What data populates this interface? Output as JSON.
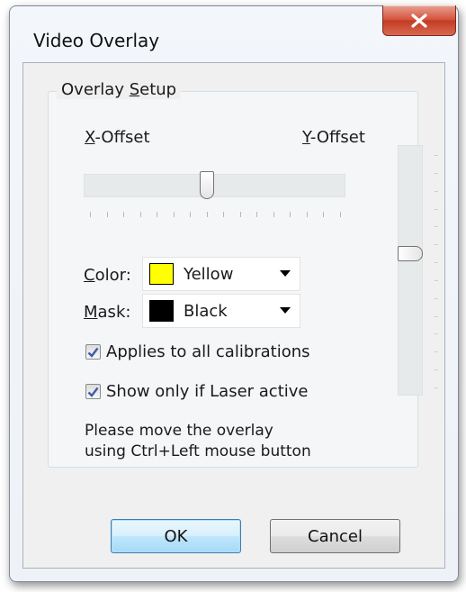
{
  "window": {
    "title": "Video Overlay"
  },
  "group": {
    "legend_prefix": "Overlay ",
    "legend_underline": "S",
    "legend_suffix": "etup"
  },
  "x_offset": {
    "underline": "X",
    "rest": "-Offset",
    "value_fraction": 0.47
  },
  "y_offset": {
    "underline": "Y",
    "rest": "-Offset",
    "value_fraction": 0.43
  },
  "color": {
    "label_underline": "C",
    "label_rest": "olor:",
    "selected": "Yellow",
    "swatch": "#ffff00"
  },
  "mask": {
    "label_underline": "M",
    "label_rest": "ask:",
    "selected": "Black",
    "swatch": "#000000"
  },
  "checkboxes": [
    {
      "label": "Applies to all calibrations",
      "checked": true
    },
    {
      "label": "Show only if Laser active",
      "checked": true
    }
  ],
  "note": {
    "line1": "Please move the overlay",
    "line2": "using Ctrl+Left mouse button"
  },
  "buttons": {
    "ok": "OK",
    "cancel": "Cancel"
  },
  "icons": {
    "close": "close-icon",
    "dropdown": "chevron-down-icon",
    "check": "checkmark-icon"
  }
}
